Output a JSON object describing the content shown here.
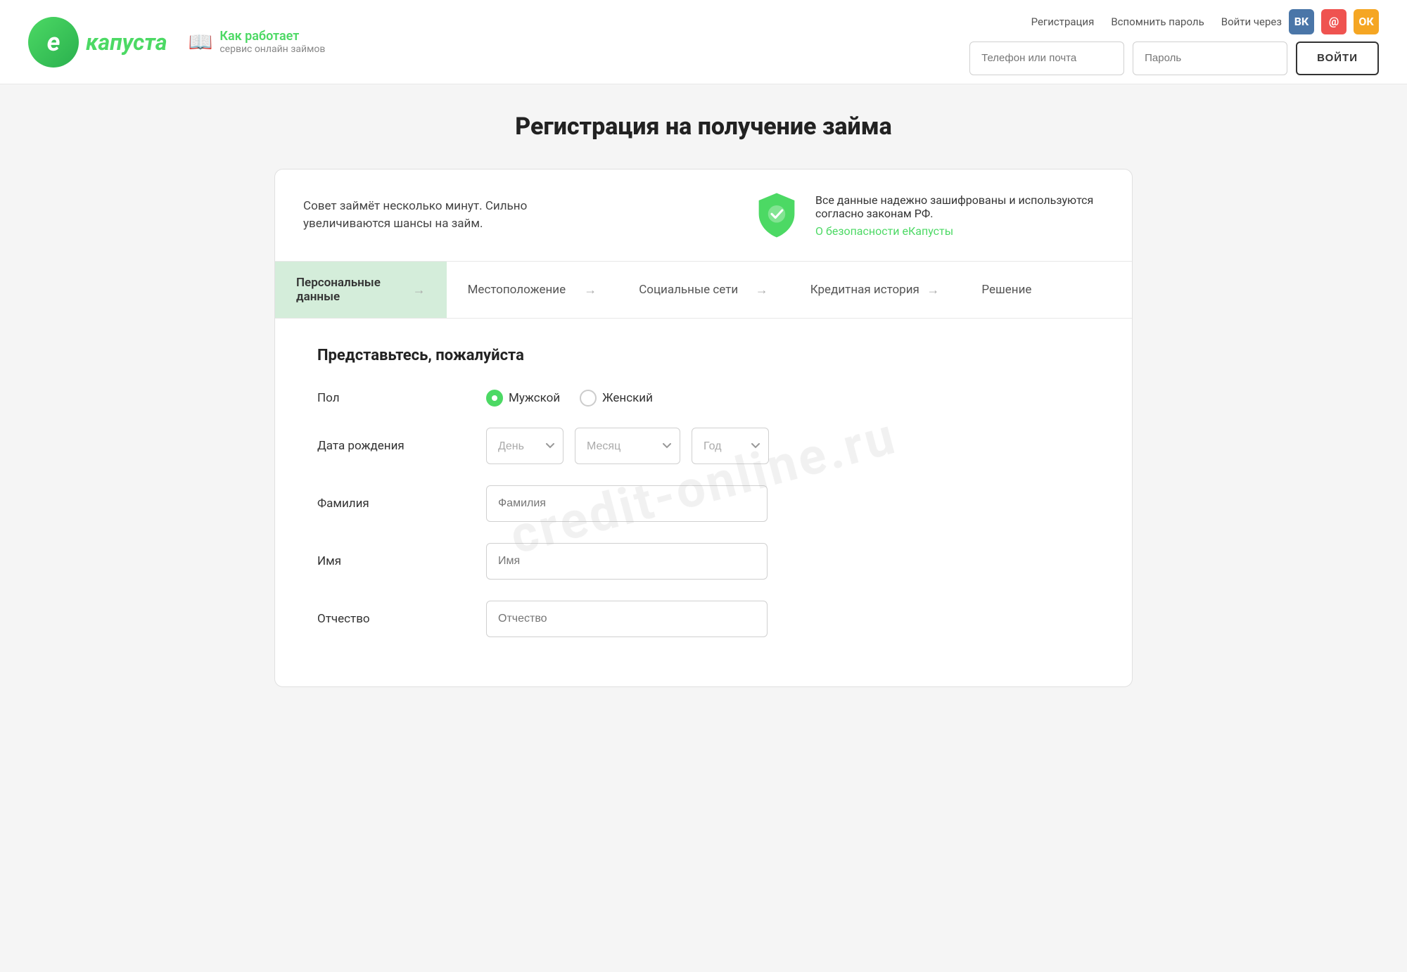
{
  "header": {
    "logo_letter": "e",
    "logo_name": "капуста",
    "how_it_works_line1": "Как работает",
    "how_it_works_line2": "сервис онлайн займов",
    "register_link": "Регистрация",
    "remember_password_link": "Вспомнить пароль",
    "login_via_label": "Войти через",
    "phone_placeholder": "Телефон или почта",
    "password_placeholder": "Пароль",
    "login_button": "ВОЙТИ"
  },
  "page": {
    "title": "Регистрация на получение займа"
  },
  "info_banner": {
    "left_text": "Совет займёт несколько минут. Сильно увеличиваются шансы на займ.",
    "right_text": "Все данные надежно зашифрованы и используются согласно законам РФ.",
    "security_link": "О безопасности еКапусты"
  },
  "steps": [
    {
      "label": "Персональные данные",
      "active": true
    },
    {
      "label": "Местоположение",
      "active": false
    },
    {
      "label": "Социальные сети",
      "active": false
    },
    {
      "label": "Кредитная история",
      "active": false
    },
    {
      "label": "Решение",
      "active": false
    }
  ],
  "form": {
    "section_title": "Представьтесь, пожалуйста",
    "gender_label": "Пол",
    "gender_male": "Мужской",
    "gender_female": "Женский",
    "birthdate_label": "Дата рождения",
    "day_placeholder": "День",
    "month_placeholder": "Месяц",
    "year_placeholder": "Год",
    "lastname_label": "Фамилия",
    "lastname_placeholder": "Фамилия",
    "firstname_label": "Имя",
    "firstname_placeholder": "Имя",
    "middlename_label": "Отчество",
    "middlename_placeholder": "Отчество"
  },
  "watermark": {
    "text": "credit-online.ru"
  },
  "social": {
    "vk_label": "ВК",
    "mail_label": "@",
    "ok_label": "ОК"
  }
}
